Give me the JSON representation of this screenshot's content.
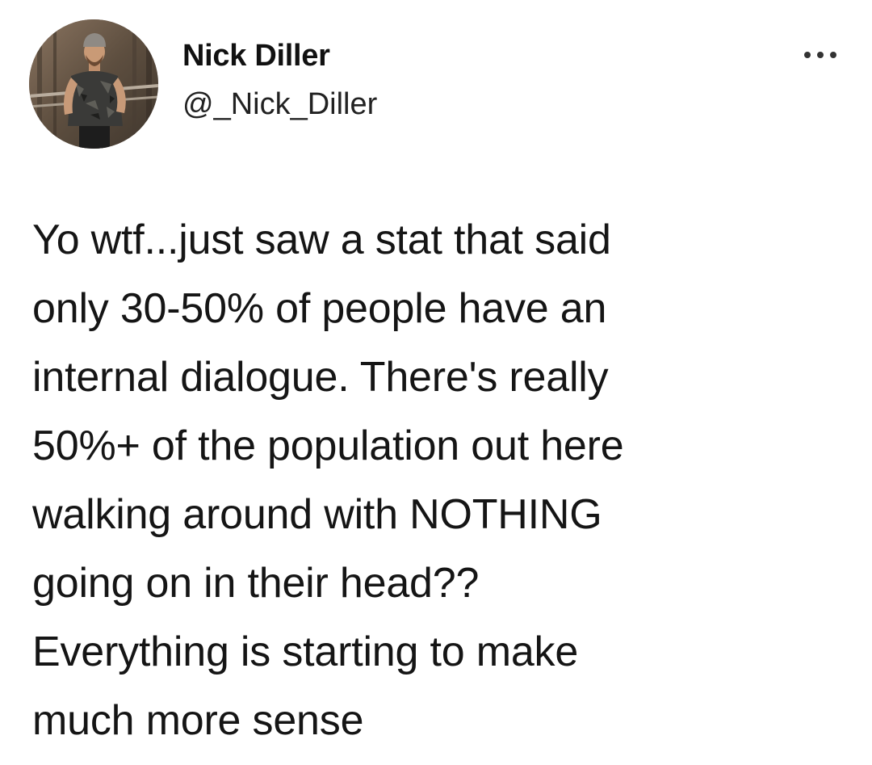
{
  "author": {
    "display_name": "Nick Diller",
    "handle": "@_Nick_Diller"
  },
  "menu": {
    "icon": "more-horizontal-icon"
  },
  "tweet": {
    "lines": [
      "Yo wtf...just saw a stat that said",
      "only 30-50% of people have an",
      "internal dialogue.  There's really",
      "50%+ of the population out here",
      "walking around with NOTHING",
      "going on in their head??",
      "Everything is starting to make",
      "much more sense"
    ]
  },
  "colors": {
    "background": "#ffffff",
    "text": "#151515",
    "icon": "#333333"
  }
}
